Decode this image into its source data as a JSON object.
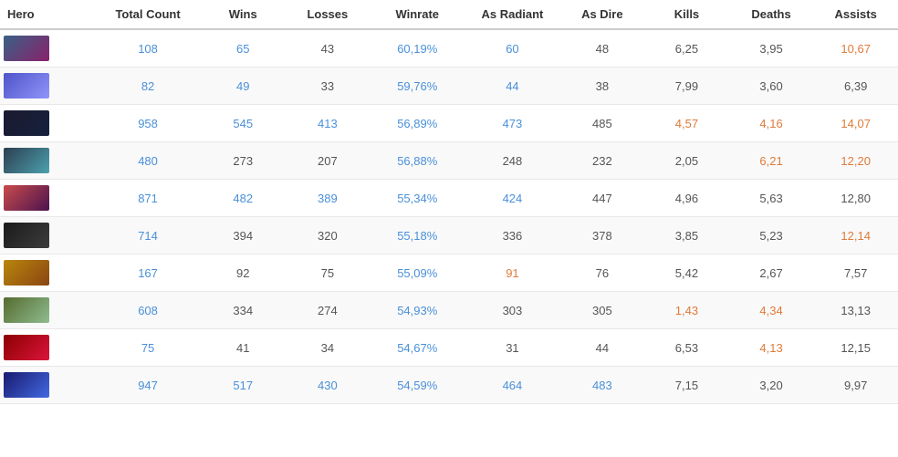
{
  "table": {
    "headers": [
      "Hero",
      "Total Count",
      "Wins",
      "Losses",
      "Winrate",
      "As Radiant",
      "As Dire",
      "Kills",
      "Deaths",
      "Assists"
    ],
    "rows": [
      {
        "hero_class": "h1",
        "total": "108",
        "wins": "65",
        "losses": "43",
        "winrate": "60,19%",
        "radiant": "60",
        "dire": "48",
        "kills": "6,25",
        "deaths": "3,95",
        "assists": "10,67",
        "total_color": "blue",
        "wins_color": "blue",
        "losses_color": "default",
        "winrate_color": "blue",
        "radiant_color": "blue",
        "dire_color": "default",
        "kills_color": "default",
        "deaths_color": "default",
        "assists_color": "orange"
      },
      {
        "hero_class": "h2",
        "total": "82",
        "wins": "49",
        "losses": "33",
        "winrate": "59,76%",
        "radiant": "44",
        "dire": "38",
        "kills": "7,99",
        "deaths": "3,60",
        "assists": "6,39",
        "total_color": "blue",
        "wins_color": "blue",
        "losses_color": "default",
        "winrate_color": "blue",
        "radiant_color": "blue",
        "dire_color": "default",
        "kills_color": "default",
        "deaths_color": "default",
        "assists_color": "default"
      },
      {
        "hero_class": "h3",
        "total": "958",
        "wins": "545",
        "losses": "413",
        "winrate": "56,89%",
        "radiant": "473",
        "dire": "485",
        "kills": "4,57",
        "deaths": "4,16",
        "assists": "14,07",
        "total_color": "blue",
        "wins_color": "blue",
        "losses_color": "blue",
        "winrate_color": "blue",
        "radiant_color": "blue",
        "dire_color": "default",
        "kills_color": "orange",
        "deaths_color": "orange",
        "assists_color": "orange"
      },
      {
        "hero_class": "h4",
        "total": "480",
        "wins": "273",
        "losses": "207",
        "winrate": "56,88%",
        "radiant": "248",
        "dire": "232",
        "kills": "2,05",
        "deaths": "6,21",
        "assists": "12,20",
        "total_color": "blue",
        "wins_color": "default",
        "losses_color": "default",
        "winrate_color": "blue",
        "radiant_color": "default",
        "dire_color": "default",
        "kills_color": "default",
        "deaths_color": "orange",
        "assists_color": "orange"
      },
      {
        "hero_class": "h5",
        "total": "871",
        "wins": "482",
        "losses": "389",
        "winrate": "55,34%",
        "radiant": "424",
        "dire": "447",
        "kills": "4,96",
        "deaths": "5,63",
        "assists": "12,80",
        "total_color": "blue",
        "wins_color": "blue",
        "losses_color": "blue",
        "winrate_color": "blue",
        "radiant_color": "blue",
        "dire_color": "default",
        "kills_color": "default",
        "deaths_color": "default",
        "assists_color": "default"
      },
      {
        "hero_class": "h6",
        "total": "714",
        "wins": "394",
        "losses": "320",
        "winrate": "55,18%",
        "radiant": "336",
        "dire": "378",
        "kills": "3,85",
        "deaths": "5,23",
        "assists": "12,14",
        "total_color": "blue",
        "wins_color": "default",
        "losses_color": "default",
        "winrate_color": "blue",
        "radiant_color": "default",
        "dire_color": "default",
        "kills_color": "default",
        "deaths_color": "default",
        "assists_color": "orange"
      },
      {
        "hero_class": "h7",
        "total": "167",
        "wins": "92",
        "losses": "75",
        "winrate": "55,09%",
        "radiant": "91",
        "dire": "76",
        "kills": "5,42",
        "deaths": "2,67",
        "assists": "7,57",
        "total_color": "blue",
        "wins_color": "default",
        "losses_color": "default",
        "winrate_color": "blue",
        "radiant_color": "orange",
        "dire_color": "default",
        "kills_color": "default",
        "deaths_color": "default",
        "assists_color": "default"
      },
      {
        "hero_class": "h8",
        "total": "608",
        "wins": "334",
        "losses": "274",
        "winrate": "54,93%",
        "radiant": "303",
        "dire": "305",
        "kills": "1,43",
        "deaths": "4,34",
        "assists": "13,13",
        "total_color": "blue",
        "wins_color": "default",
        "losses_color": "default",
        "winrate_color": "blue",
        "radiant_color": "default",
        "dire_color": "default",
        "kills_color": "orange",
        "deaths_color": "orange",
        "assists_color": "default"
      },
      {
        "hero_class": "h9",
        "total": "75",
        "wins": "41",
        "losses": "34",
        "winrate": "54,67%",
        "radiant": "31",
        "dire": "44",
        "kills": "6,53",
        "deaths": "4,13",
        "assists": "12,15",
        "total_color": "blue",
        "wins_color": "default",
        "losses_color": "default",
        "winrate_color": "blue",
        "radiant_color": "default",
        "dire_color": "default",
        "kills_color": "default",
        "deaths_color": "orange",
        "assists_color": "default"
      },
      {
        "hero_class": "h10",
        "total": "947",
        "wins": "517",
        "losses": "430",
        "winrate": "54,59%",
        "radiant": "464",
        "dire": "483",
        "kills": "7,15",
        "deaths": "3,20",
        "assists": "9,97",
        "total_color": "blue",
        "wins_color": "blue",
        "losses_color": "blue",
        "winrate_color": "blue",
        "radiant_color": "blue",
        "dire_color": "blue",
        "kills_color": "default",
        "deaths_color": "default",
        "assists_color": "default"
      }
    ]
  }
}
